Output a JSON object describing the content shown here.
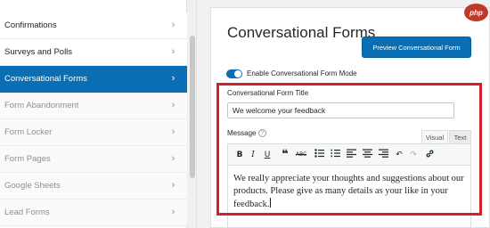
{
  "sidebar": {
    "items": [
      {
        "label": "Confirmations",
        "state": "normal"
      },
      {
        "label": "Surveys and Polls",
        "state": "normal"
      },
      {
        "label": "Conversational Forms",
        "state": "active"
      },
      {
        "label": "Form Abandonment",
        "state": "muted"
      },
      {
        "label": "Form Locker",
        "state": "muted"
      },
      {
        "label": "Form Pages",
        "state": "muted"
      },
      {
        "label": "Google Sheets",
        "state": "muted"
      },
      {
        "label": "Lead Forms",
        "state": "muted"
      }
    ],
    "chevron": "›"
  },
  "panel": {
    "title": "Conversational Forms",
    "preview_button": "Preview Conversational Form",
    "toggle": {
      "label": "Enable Conversational Form Mode",
      "on": true
    },
    "form_title": {
      "label": "Conversational Form Title",
      "value": "We welcome your feedback"
    },
    "message": {
      "label": "Message",
      "help_glyph": "?",
      "tabs": {
        "visual": "Visual",
        "text": "Text"
      },
      "body": "We really appreciate your thoughts and suggestions about our products. Please give as many details as your like in your feedback."
    }
  },
  "toolbar_icons": [
    "bold-icon",
    "italic-icon",
    "underline-icon",
    "blockquote-icon",
    "strikethrough-icon",
    "bullet-list-icon",
    "numbered-list-icon",
    "align-left-icon",
    "align-center-icon",
    "align-right-icon",
    "undo-icon",
    "redo-icon",
    "link-icon"
  ],
  "watermark": "php",
  "colors": {
    "accent": "#0a6eb4",
    "highlight": "#d2222d"
  }
}
